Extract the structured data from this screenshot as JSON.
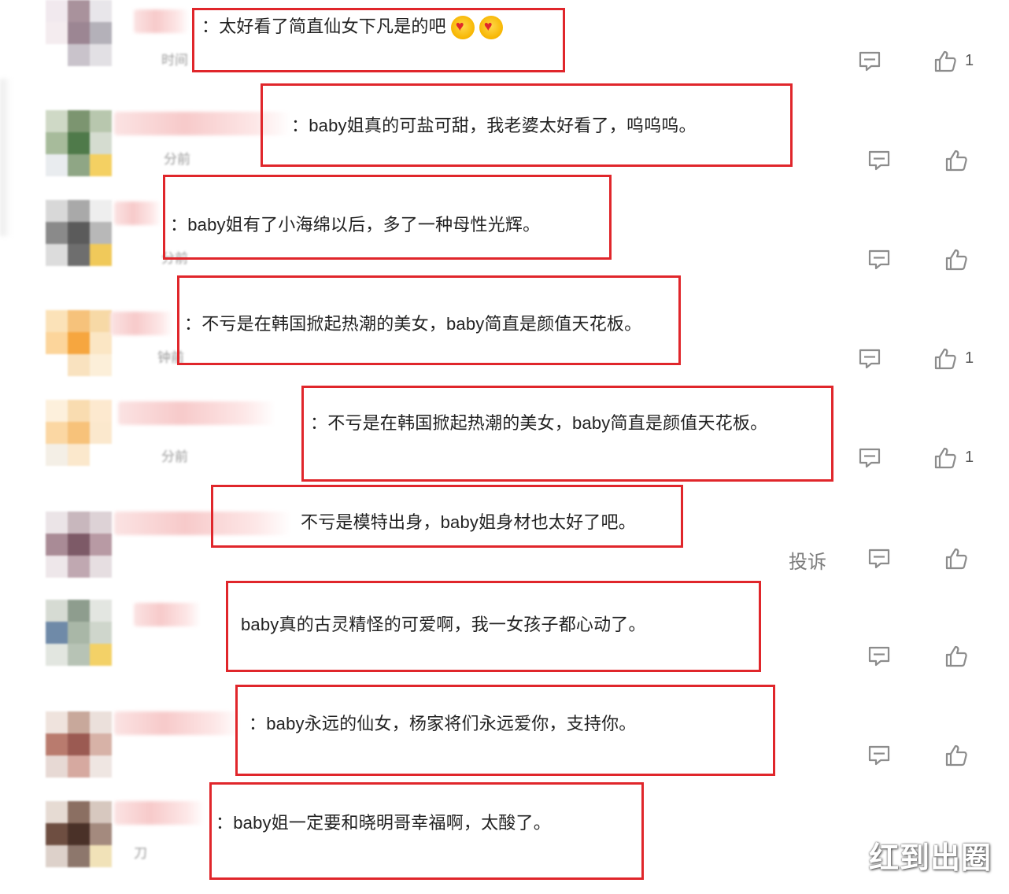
{
  "comments": [
    {
      "text": "：太好看了简直仙女下凡是的吧",
      "emojis": [
        "heart-eyes-emoji",
        "heart-eyes-emoji"
      ],
      "time": "时间",
      "likes": "1",
      "avatar_colors": [
        "#f1e9ee",
        "#a9929c",
        "#e8e6ea",
        "#f4ecef",
        "#9c8693",
        "#b4b1b9",
        "#ffffff",
        "#c9c3cb",
        "#e2e0e4"
      ]
    },
    {
      "text": "：baby姐真的可盐可甜，我老婆太好看了，呜呜呜。",
      "time": "分前",
      "likes": "",
      "avatar_colors": [
        "#cfd9c6",
        "#7c9570",
        "#b8c7ae",
        "#a7bb9b",
        "#4f7a4a",
        "#d5dcd0",
        "#e9ecef",
        "#8fa685",
        "#f4d062"
      ]
    },
    {
      "text": "：baby姐有了小海绵以后，多了一种母性光辉。",
      "time": "分前",
      "likes": "",
      "avatar_colors": [
        "#d8d8d8",
        "#a9a9a9",
        "#eeeeee",
        "#8a8a8a",
        "#5b5b5b",
        "#b8b8b8",
        "#dcdcdc",
        "#6e6e6e",
        "#f0c95a"
      ]
    },
    {
      "text": "：不亏是在韩国掀起热潮的美女，baby简直是颜值天花板。",
      "time": "钟前",
      "likes": "1",
      "avatar_colors": [
        "#fbe2b8",
        "#f6c27b",
        "#f7d9a6",
        "#fcd59b",
        "#f6a63f",
        "#fbe6c4",
        "#ffffff",
        "#f9e2bf",
        "#fcefd9"
      ]
    },
    {
      "text": "：不亏是在韩国掀起热潮的美女，baby简直是颜值天花板。",
      "time": "分前",
      "likes": "1",
      "avatar_colors": [
        "#fdf0dc",
        "#f9dcb0",
        "#fde9cf",
        "#fbd7a3",
        "#f7c27a",
        "#fbe8cd",
        "#f4efe6",
        "#fbe8cc",
        "#ffffff"
      ]
    },
    {
      "text": "不亏是模特出身，baby姐身材也太好了吧。",
      "time": "",
      "likes": "",
      "report": "投诉",
      "avatar_colors": [
        "#ebe4e7",
        "#c8b7bd",
        "#ddd2d6",
        "#a98b96",
        "#7d5a67",
        "#b89aa4",
        "#eee7ea",
        "#c0a8b1",
        "#e6dee1"
      ]
    },
    {
      "text": "baby真的古灵精怪的可爱啊，我一女孩子都心动了。",
      "time": "",
      "likes": "",
      "avatar_colors": [
        "#d6dbd3",
        "#8e9d8e",
        "#e3e6e1",
        "#6f8aa8",
        "#a9b7a7",
        "#cfd6cc",
        "#e2e6e0",
        "#b7c3b5",
        "#f3d167"
      ]
    },
    {
      "text": "：baby永远的仙女，杨家将们永远爱你，支持你。",
      "time": "",
      "likes": "",
      "avatar_colors": [
        "#efe3dd",
        "#c8a89b",
        "#ebe0db",
        "#b97b6e",
        "#9b5a52",
        "#d7b2a7",
        "#e7d9d4",
        "#d6a9a0",
        "#efe6e2"
      ]
    },
    {
      "text": "：baby姐一定要和晓明哥幸福啊，太酸了。",
      "time": "刀",
      "likes": "",
      "avatar_colors": [
        "#e6dbd3",
        "#8b6f62",
        "#d7c8bf",
        "#6e4e41",
        "#4a3128",
        "#a48a7e",
        "#ddd1ca",
        "#8d776c",
        "#f1e2b8"
      ]
    }
  ],
  "watermark": "红到出圈",
  "colors": {
    "highlight_box": "#e0262b",
    "text": "#222222",
    "icon": "#8c8c8c"
  },
  "icons": {
    "reply": "reply-icon",
    "like": "thumbs-up-icon"
  }
}
